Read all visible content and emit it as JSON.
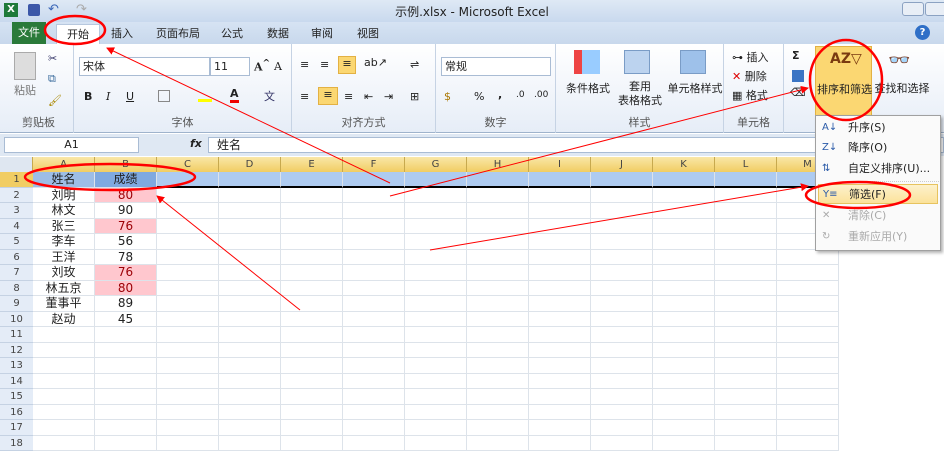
{
  "window": {
    "title": "示例.xlsx - Microsoft Excel"
  },
  "tabs": {
    "file": "文件",
    "items": [
      "开始",
      "插入",
      "页面布局",
      "公式",
      "数据",
      "审阅",
      "视图"
    ]
  },
  "ribbon": {
    "clipboard": {
      "label": "剪贴板",
      "paste": "粘贴"
    },
    "font": {
      "label": "字体",
      "name": "宋体",
      "size": "11",
      "bold": "B",
      "italic": "I",
      "underline": "U",
      "color_glyph": "A",
      "phonetic": "文"
    },
    "alignment": {
      "label": "对齐方式"
    },
    "number": {
      "label": "数字",
      "format": "常规",
      "percent": "%",
      "comma": ","
    },
    "styles": {
      "label": "样式",
      "conditional": "条件格式",
      "table_format": "套用\n表格格式",
      "cell_styles": "单元格样式"
    },
    "cells": {
      "label": "单元格",
      "insert": "插入",
      "delete": "删除",
      "format": "格式"
    },
    "editing": {
      "sum": "Σ",
      "sort_filter": "排序和筛选",
      "find_select": "查找和选择"
    }
  },
  "formula_bar": {
    "name_box": "A1",
    "fx": "fx",
    "value": "姓名"
  },
  "columns": [
    "A",
    "B",
    "C",
    "D",
    "E",
    "F",
    "G",
    "H",
    "I",
    "J",
    "K",
    "L",
    "M"
  ],
  "rows": [
    [
      "姓名",
      "成绩"
    ],
    [
      "刘明",
      "80"
    ],
    [
      "林文",
      "90"
    ],
    [
      "张三",
      "76"
    ],
    [
      "李车",
      "56"
    ],
    [
      "王洋",
      "78"
    ],
    [
      "刘玫",
      "76"
    ],
    [
      "林五京",
      "80"
    ],
    [
      "董事平",
      "89"
    ],
    [
      "赵动",
      "45"
    ],
    [
      "",
      ""
    ],
    [
      "",
      ""
    ],
    [
      "",
      ""
    ],
    [
      "",
      ""
    ],
    [
      "",
      ""
    ],
    [
      "",
      ""
    ],
    [
      "",
      ""
    ],
    [
      "",
      ""
    ]
  ],
  "highlighted_rows": [
    2,
    4,
    7,
    8
  ],
  "sort_menu": {
    "items": [
      {
        "label": "升序(S)",
        "icon": "sort-asc-icon",
        "enabled": true
      },
      {
        "label": "降序(O)",
        "icon": "sort-desc-icon",
        "enabled": true
      },
      {
        "label": "自定义排序(U)...",
        "icon": "custom-sort-icon",
        "enabled": true
      },
      {
        "label": "筛选(F)",
        "icon": "filter-icon",
        "enabled": true
      },
      {
        "label": "清除(C)",
        "icon": "clear-filter-icon",
        "enabled": false
      },
      {
        "label": "重新应用(Y)",
        "icon": "reapply-icon",
        "enabled": false
      }
    ]
  },
  "colors": {
    "highlight_fill": "#ffc7ce",
    "highlight_text": "#9c0006",
    "annotation": "#ff0000",
    "header_select": "#aecbf0"
  }
}
